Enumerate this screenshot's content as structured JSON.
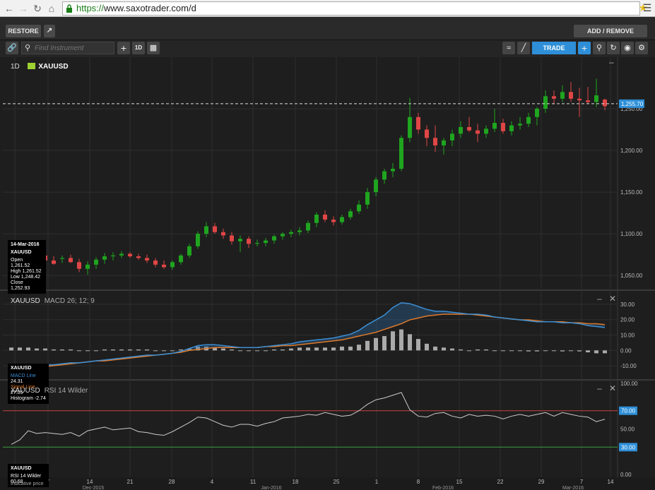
{
  "browser": {
    "url_scheme": "https://",
    "url_host": "www.saxotrader.com",
    "url_path": "/d"
  },
  "toolbar": {
    "restore_label": "RESTORE",
    "add_remove_label": "ADD / REMOVE CHARTS",
    "search_placeholder": "Find Instrument",
    "period_label": "1D",
    "trade_label": "TRADE"
  },
  "main_pane": {
    "period": "1D",
    "symbol": "XAUUSD",
    "last_price": "1,255.70",
    "price_ticks": [
      "1,250.00",
      "1,200.00",
      "1,150.00",
      "1,100.00",
      "1,050.00"
    ],
    "info": {
      "date": "14-Mar-2016",
      "symbol": "XAUUSD",
      "open_label": "Open",
      "open": "1,261.52",
      "high_label": "High",
      "high": "1,261.52",
      "low_label": "Low",
      "low": "1,248.42",
      "close_label": "Close",
      "close": "1,252.93"
    }
  },
  "macd_pane": {
    "symbol": "XAUUSD",
    "indicator": "MACD 26; 12; 9",
    "ticks": [
      "30.00",
      "20.00",
      "10.00",
      "0.00",
      "-10.00"
    ],
    "info": {
      "symbol": "XAUUSD",
      "macd_label": "MACD Line",
      "macd": "24.31",
      "signal_label": "Signal Line",
      "signal": "27.05",
      "hist_label": "Histogram",
      "hist": "-2.74"
    }
  },
  "rsi_pane": {
    "symbol": "XAUUSD",
    "indicator": "RSI 14 Wilder",
    "ticks": [
      "100.00",
      "50.00",
      "0.00"
    ],
    "upper_level": "70.00",
    "lower_level": "30.00",
    "info": {
      "symbol": "XAUUSD",
      "rsi_label": "RSI 14 Wilder",
      "rsi": "60.68",
      "note": "Indicative price"
    }
  },
  "x_axis": {
    "days": [
      "30",
      "7",
      "14",
      "21",
      "28",
      "4",
      "11",
      "18",
      "25",
      "1",
      "8",
      "15",
      "22",
      "29",
      "7",
      "14"
    ],
    "months": [
      "Dec-2015",
      "Jan-2016",
      "Feb-2016",
      "Mar-2016"
    ]
  },
  "colors": {
    "up": "#1fa51f",
    "down": "#e04646",
    "macd": "#3b8fd6",
    "signal": "#e07a2a",
    "accent": "#2e8fd8"
  },
  "chart_data": {
    "type": "candlestick",
    "symbol": "XAUUSD",
    "ylim": [
      1040,
      1305
    ],
    "candles": [
      [
        1069,
        1077,
        1058,
        1062
      ],
      [
        1070,
        1078,
        1064,
        1073
      ],
      [
        1073,
        1076,
        1066,
        1070
      ],
      [
        1070,
        1077,
        1068,
        1074
      ],
      [
        1074,
        1078,
        1065,
        1068
      ],
      [
        1068,
        1073,
        1063,
        1064
      ],
      [
        1070,
        1074,
        1065,
        1071
      ],
      [
        1071,
        1075,
        1065,
        1066
      ],
      [
        1066,
        1070,
        1054,
        1058
      ],
      [
        1058,
        1067,
        1051,
        1063
      ],
      [
        1063,
        1072,
        1058,
        1069
      ],
      [
        1069,
        1077,
        1064,
        1073
      ],
      [
        1073,
        1078,
        1068,
        1074
      ],
      [
        1074,
        1079,
        1071,
        1076
      ],
      [
        1076,
        1078,
        1071,
        1073
      ],
      [
        1073,
        1076,
        1069,
        1071
      ],
      [
        1071,
        1075,
        1065,
        1068
      ],
      [
        1068,
        1071,
        1060,
        1063
      ],
      [
        1063,
        1068,
        1058,
        1060
      ],
      [
        1060,
        1068,
        1057,
        1066
      ],
      [
        1066,
        1076,
        1063,
        1074
      ],
      [
        1074,
        1088,
        1071,
        1085
      ],
      [
        1085,
        1103,
        1082,
        1100
      ],
      [
        1100,
        1114,
        1096,
        1109
      ],
      [
        1109,
        1113,
        1100,
        1102
      ],
      [
        1102,
        1106,
        1094,
        1098
      ],
      [
        1098,
        1102,
        1087,
        1091
      ],
      [
        1091,
        1098,
        1078,
        1094
      ],
      [
        1094,
        1097,
        1083,
        1088
      ],
      [
        1088,
        1093,
        1085,
        1089
      ],
      [
        1089,
        1095,
        1085,
        1092
      ],
      [
        1092,
        1099,
        1088,
        1097
      ],
      [
        1097,
        1102,
        1093,
        1100
      ],
      [
        1100,
        1105,
        1096,
        1102
      ],
      [
        1102,
        1108,
        1098,
        1104
      ],
      [
        1104,
        1116,
        1101,
        1113
      ],
      [
        1113,
        1126,
        1108,
        1123
      ],
      [
        1123,
        1128,
        1114,
        1117
      ],
      [
        1117,
        1121,
        1110,
        1114
      ],
      [
        1114,
        1123,
        1111,
        1120
      ],
      [
        1120,
        1130,
        1117,
        1127
      ],
      [
        1127,
        1140,
        1124,
        1135
      ],
      [
        1135,
        1155,
        1130,
        1150
      ],
      [
        1150,
        1168,
        1145,
        1165
      ],
      [
        1165,
        1178,
        1160,
        1175
      ],
      [
        1175,
        1185,
        1168,
        1178
      ],
      [
        1178,
        1218,
        1175,
        1215
      ],
      [
        1215,
        1263,
        1210,
        1240
      ],
      [
        1240,
        1245,
        1220,
        1225
      ],
      [
        1225,
        1230,
        1205,
        1215
      ],
      [
        1215,
        1230,
        1198,
        1206
      ],
      [
        1206,
        1215,
        1195,
        1212
      ],
      [
        1212,
        1225,
        1205,
        1220
      ],
      [
        1220,
        1235,
        1215,
        1228
      ],
      [
        1228,
        1240,
        1222,
        1224
      ],
      [
        1224,
        1232,
        1210,
        1220
      ],
      [
        1220,
        1230,
        1215,
        1226
      ],
      [
        1226,
        1250,
        1222,
        1233
      ],
      [
        1233,
        1238,
        1220,
        1223
      ],
      [
        1223,
        1235,
        1218,
        1230
      ],
      [
        1230,
        1240,
        1225,
        1232
      ],
      [
        1232,
        1245,
        1228,
        1240
      ],
      [
        1240,
        1252,
        1230,
        1250
      ],
      [
        1250,
        1272,
        1245,
        1265
      ],
      [
        1265,
        1272,
        1255,
        1262
      ],
      [
        1262,
        1278,
        1258,
        1270
      ],
      [
        1270,
        1282,
        1258,
        1262
      ],
      [
        1262,
        1275,
        1240,
        1260
      ],
      [
        1260,
        1276,
        1256,
        1258
      ],
      [
        1258,
        1286,
        1252,
        1266
      ],
      [
        1261,
        1262,
        1248,
        1253
      ]
    ],
    "macd": [
      -18,
      -17,
      -16,
      -16,
      -15,
      -15,
      -14,
      -13,
      -13,
      -12,
      -11,
      -10,
      -9,
      -8,
      -7,
      -6,
      -5,
      -5,
      -4,
      -3,
      -1,
      2,
      5,
      6,
      6,
      5,
      4,
      3,
      3,
      3,
      4,
      5,
      6,
      7,
      9,
      10,
      11,
      12,
      13,
      15,
      17,
      21,
      27,
      32,
      37,
      45,
      50,
      49,
      46,
      43,
      41,
      41,
      40,
      39,
      38,
      38,
      37,
      35,
      34,
      33,
      32,
      31,
      30,
      30,
      30,
      29,
      29,
      28,
      26,
      25,
      24
    ],
    "signal": [
      -21,
      -20,
      -19,
      -18,
      -17,
      -16,
      -15,
      -14,
      -13,
      -12,
      -11,
      -11,
      -10,
      -9,
      -8,
      -7,
      -6,
      -5,
      -4,
      -3,
      -2,
      0,
      1,
      2,
      3,
      3,
      3,
      3,
      3,
      3,
      4,
      4,
      5,
      5,
      6,
      7,
      8,
      9,
      10,
      11,
      13,
      15,
      17,
      19,
      22,
      25,
      28,
      32,
      34,
      36,
      37,
      38,
      38,
      38,
      38,
      37,
      36,
      35,
      34,
      33,
      32,
      32,
      31,
      30,
      30,
      30,
      29,
      29,
      28,
      28,
      27
    ],
    "hist": [
      3,
      3,
      3,
      2,
      2,
      1,
      1,
      1,
      0,
      0,
      0,
      1,
      1,
      1,
      1,
      1,
      1,
      0,
      0,
      0,
      1,
      2,
      4,
      4,
      3,
      2,
      1,
      0,
      0,
      0,
      0,
      1,
      1,
      2,
      3,
      3,
      3,
      3,
      3,
      4,
      4,
      6,
      10,
      13,
      15,
      20,
      22,
      17,
      12,
      7,
      4,
      3,
      2,
      1,
      0,
      1,
      1,
      0,
      0,
      0,
      0,
      -1,
      -1,
      0,
      0,
      -1,
      0,
      -1,
      -2,
      -3,
      -3
    ],
    "rsi": [
      33,
      38,
      48,
      45,
      46,
      45,
      44,
      46,
      42,
      48,
      50,
      52,
      49,
      50,
      51,
      47,
      46,
      44,
      43,
      47,
      52,
      57,
      63,
      62,
      58,
      54,
      52,
      55,
      55,
      53,
      56,
      58,
      62,
      63,
      64,
      66,
      65,
      68,
      66,
      64,
      65,
      70,
      77,
      82,
      84,
      87,
      90,
      71,
      64,
      63,
      67,
      68,
      64,
      62,
      66,
      64,
      65,
      64,
      61,
      64,
      66,
      64,
      66,
      68,
      64,
      68,
      66,
      64,
      63,
      58,
      60.68
    ]
  }
}
